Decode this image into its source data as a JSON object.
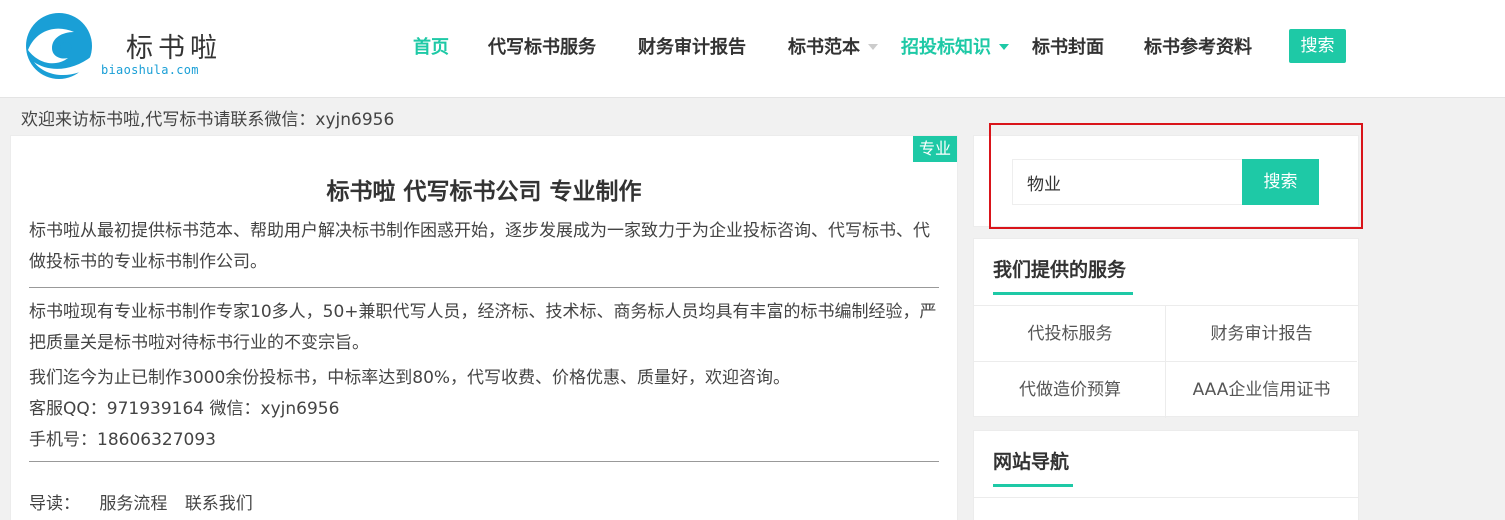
{
  "logo": {
    "name": "标书啦",
    "domain": "biaoshula.com"
  },
  "nav": {
    "items": [
      {
        "label": "首页"
      },
      {
        "label": "代写标书服务"
      },
      {
        "label": "财务审计报告"
      },
      {
        "label": "标书范本"
      },
      {
        "label": "招投标知识"
      },
      {
        "label": "标书封面"
      },
      {
        "label": "标书参考资料"
      }
    ],
    "search_label": "搜索"
  },
  "welcome": "欢迎来访标书啦,代写标书请联系微信：xyjn6956",
  "main": {
    "badge": "专业",
    "title": "标书啦 代写标书公司 专业制作",
    "intro": "标书啦从最初提供标书范本、帮助用户解决标书制作困惑开始，逐步发展成为一家致力于为企业投标咨询、代写标书、代做投标书的专业标书制作公司。",
    "detail": "标书啦现有专业标书制作专家10多人，50+兼职代写人员，经济标、技术标、商务标人员均具有丰富的标书编制经验，严把质量关是标书啦对待标书行业的不变宗旨。",
    "stats": "我们迄今为止已制作3000余份投标书，中标率达到80%，代写收费、价格优惠、质量好，欢迎咨询。",
    "contact_qq": "客服QQ：971939164 微信：xyjn6956",
    "contact_phone": "手机号：18606327093",
    "guide_label": "导读：",
    "guide_links": [
      "服务流程",
      "联系我们"
    ]
  },
  "sidebar": {
    "search": {
      "value": "物业",
      "button": "搜索"
    },
    "services": {
      "title": "我们提供的服务",
      "items": [
        "代投标服务",
        "财务审计报告",
        "代做造价预算",
        "AAA企业信用证书"
      ]
    },
    "site_nav": {
      "title": "网站导航"
    }
  },
  "colors": {
    "accent": "#1ec9a6",
    "highlight_border": "#d9141a"
  }
}
